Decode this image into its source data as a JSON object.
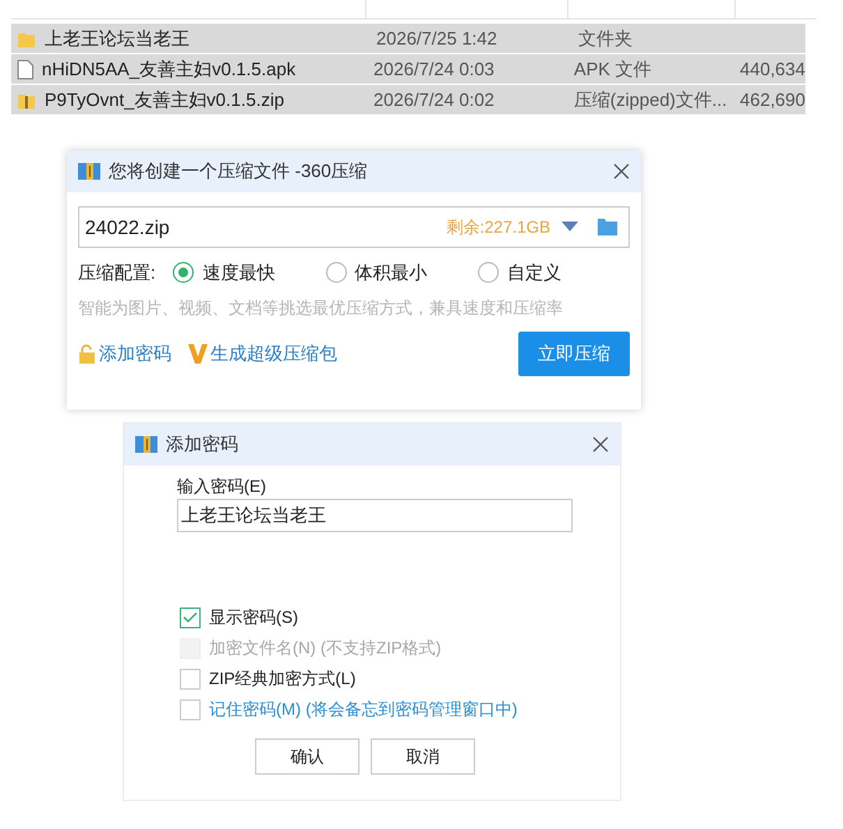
{
  "files": [
    {
      "kind": "folder",
      "name": "上老王论坛当老王",
      "modified": "2026/7/25 1:42",
      "type": "文件夹"
    },
    {
      "kind": "file",
      "name": "nHiDN5AA_友善主妇v0.1.5.apk",
      "modified": "2026/7/24 0:03",
      "type": "APK 文件",
      "size": "440,634"
    },
    {
      "kind": "zip",
      "name": "P9TyOvnt_友善主妇v0.1.5.zip",
      "modified": "2026/7/24 0:02",
      "type": "压缩(zipped)文件...",
      "size": "462,690"
    }
  ],
  "compress_dialog": {
    "title": "您将创建一个压缩文件 -360压缩",
    "filename": "24022.zip",
    "free_space": "剩余:227.1GB",
    "config_label": "压缩配置:",
    "options": [
      {
        "label": "速度最快",
        "selected": true
      },
      {
        "label": "体积最小",
        "selected": false
      },
      {
        "label": "自定义",
        "selected": false
      }
    ],
    "hint": "智能为图片、视频、文档等挑选最优压缩方式，兼具速度和压缩率",
    "add_password": "添加密码",
    "super_package": "生成超级压缩包",
    "compress_button": "立即压缩"
  },
  "password_dialog": {
    "title": "添加密码",
    "password_label": "输入密码(E)",
    "password_value": "上老王论坛当老王",
    "checkboxes": [
      {
        "kind": "plain",
        "label": "显示密码(S)",
        "checked": true,
        "disabled": false
      },
      {
        "kind": "plain",
        "label": "加密文件名(N) (不支持ZIP格式)",
        "checked": false,
        "disabled": true
      },
      {
        "kind": "plain",
        "label": "ZIP经典加密方式(L)",
        "checked": false,
        "disabled": false
      },
      {
        "kind": "link",
        "label": "记住密码(M) (将会备忘到密码管理窗口中)",
        "checked": false,
        "disabled": false
      }
    ],
    "buttons": [
      "确认",
      "取消"
    ]
  }
}
